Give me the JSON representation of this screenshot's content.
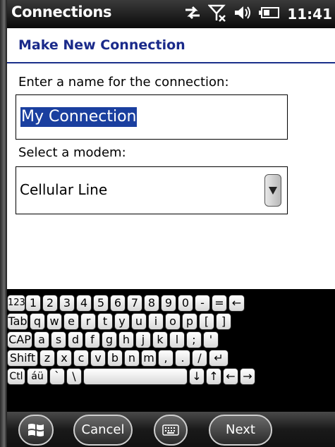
{
  "statusbar": {
    "title": "Connections",
    "clock": "11:41",
    "icons": [
      "data-sync-icon",
      "no-signal-icon",
      "volume-icon",
      "battery-icon"
    ]
  },
  "page": {
    "header": "Make New Connection",
    "name_label": "Enter a name for the connection:",
    "name_value": "My Connection",
    "modem_label": "Select a modem:",
    "modem_value": "Cellular Line"
  },
  "keyboard": {
    "rows": [
      [
        "123",
        "1",
        "2",
        "3",
        "4",
        "5",
        "6",
        "7",
        "8",
        "9",
        "0",
        "-",
        "=",
        "←"
      ],
      [
        "Tab",
        "q",
        "w",
        "e",
        "r",
        "t",
        "y",
        "u",
        "i",
        "o",
        "p",
        "[",
        "]"
      ],
      [
        "CAP",
        "a",
        "s",
        "d",
        "f",
        "g",
        "h",
        "j",
        "k",
        "l",
        ";",
        "'"
      ],
      [
        "Shift",
        "z",
        "x",
        "c",
        "v",
        "b",
        "n",
        "m",
        ",",
        ".",
        "/",
        "↵"
      ],
      [
        "Ctl",
        "áü",
        "`",
        "\\",
        " ",
        "↓",
        "↑",
        "←",
        "→"
      ]
    ]
  },
  "bottombar": {
    "cancel_label": "Cancel",
    "next_label": "Next"
  },
  "colors": {
    "header_text": "#1a2a8a",
    "selection": "#1a3f9f"
  }
}
